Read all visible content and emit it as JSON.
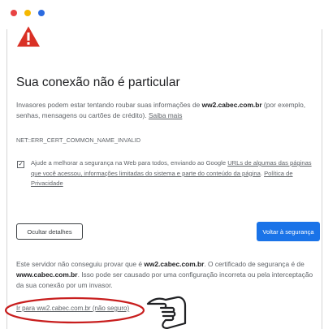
{
  "colors": {
    "dot_red": "#e84343",
    "dot_yellow": "#f5b800",
    "dot_blue": "#2b6be0",
    "warning_red": "#d93025",
    "primary_button": "#1a73e8",
    "highlight_oval": "#c81e1e"
  },
  "icons": {
    "warning": "warning-triangle-icon",
    "pointer": "pointing-hand-icon"
  },
  "title": "Sua conexão não é particular",
  "intro": {
    "text_before_domain": "Invasores podem estar tentando roubar suas informações de ",
    "domain": "ww2.cabec.com.br",
    "text_after_domain": " (por exemplo, senhas, mensagens ou cartões de crédito). ",
    "learn_more_link": "Saiba mais"
  },
  "error_code": "NET::ERR_CERT_COMMON_NAME_INVALID",
  "optin": {
    "checked": true,
    "text_before_link": "Ajude a melhorar a segurança na Web para todos, enviando ao Google ",
    "link_text": "URLs de algumas das páginas que você acessou, informações limitadas do sistema e parte do conteúdo da página",
    "text_after_link": ". ",
    "privacy_link": "Política de Privacidade"
  },
  "buttons": {
    "hide_details": "Ocultar detalhes",
    "back_to_safety": "Voltar à segurança"
  },
  "details": {
    "text_1": "Este servidor não conseguiu provar que é ",
    "domain_1": "ww2.cabec.com.br",
    "text_2": ". O certificado de segurança é de ",
    "domain_2": "www.cabec.com.br",
    "text_3": ". Isso pode ser causado por uma configuração incorreta ou pela interceptação da sua conexão por um invasor."
  },
  "proceed_link": "Ir para ww2.cabec.com.br (não seguro)"
}
